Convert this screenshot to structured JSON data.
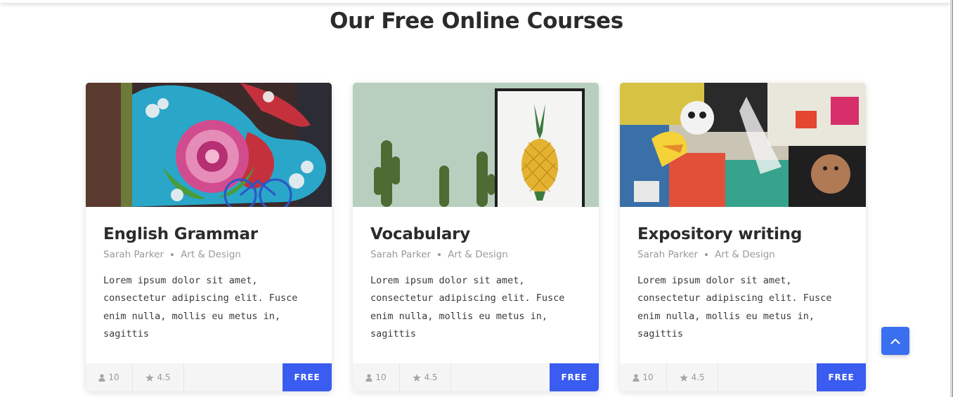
{
  "section": {
    "title": "Our Free Online Courses"
  },
  "courses": [
    {
      "title": "English Grammar",
      "author": "Sarah Parker",
      "category": "Art & Design",
      "description": "Lorem ipsum dolor sit amet, consectetur adipiscing elit. Fusce enim nulla, mollis eu metus in, sagittis",
      "students": "10",
      "rating": "4.5",
      "price": "FREE",
      "image": "street-art-snake-flower-mural"
    },
    {
      "title": "Vocabulary",
      "author": "Sarah Parker",
      "category": "Art & Design",
      "description": "Lorem ipsum dolor sit amet, consectetur adipiscing elit. Fusce enim nulla, mollis eu metus in, sagittis",
      "students": "10",
      "rating": "4.5",
      "price": "FREE",
      "image": "cactus-and-pineapple-poster"
    },
    {
      "title": "Expository writing",
      "author": "Sarah Parker",
      "category": "Art & Design",
      "description": "Lorem ipsum dolor sit amet, consectetur adipiscing elit. Fusce enim nulla, mollis eu metus in, sagittis",
      "students": "10",
      "rating": "4.5",
      "price": "FREE",
      "image": "graffiti-sticker-wall"
    }
  ],
  "icons": {
    "students": "user-icon",
    "rating": "star-icon",
    "back_to_top": "chevron-up-icon"
  },
  "colors": {
    "accent": "#3a5cf0",
    "back_to_top": "#3a6ff0"
  }
}
